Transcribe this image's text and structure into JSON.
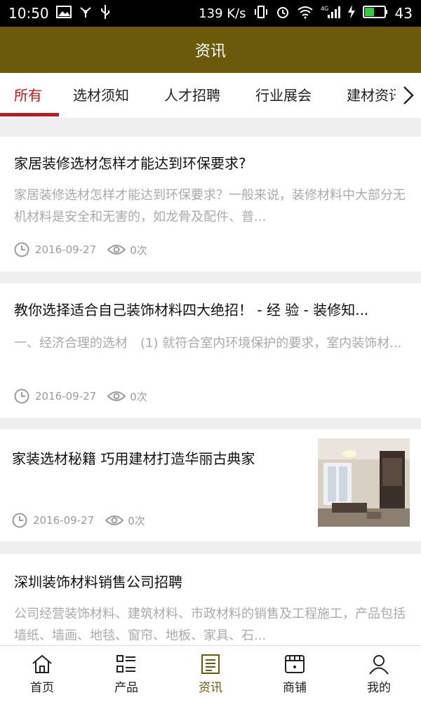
{
  "status_bar": {
    "time": "10:50",
    "speed": "139 K/s",
    "battery": "43",
    "icons": [
      "image-icon",
      "usb-icon",
      "sound-icon",
      "vibrate-icon",
      "alarm-icon",
      "wifi-icon",
      "signal-4g-icon",
      "charging-icon",
      "battery-icon"
    ]
  },
  "header": {
    "title": "资讯"
  },
  "tabs": {
    "items": [
      {
        "label": "所有",
        "active": true
      },
      {
        "label": "选材须知",
        "active": false
      },
      {
        "label": "人才招聘",
        "active": false
      },
      {
        "label": "行业展会",
        "active": false
      },
      {
        "label": "建材资讯",
        "active": false
      }
    ],
    "more_icon": "chevron-right-icon"
  },
  "articles": [
    {
      "title": "家居装修选材怎样才能达到环保要求?",
      "summary": "家居装修选材怎样才能达到环保要求？一般来说，装修材料中大部分无机材料是安全和无害的，如龙骨及配件、普...",
      "date": "2016-09-27",
      "views": "0次"
    },
    {
      "title": "教你选择适合自己装饰材料四大绝招！ - 经 验 - 装修知...",
      "summary": "一、经济合理的选材　(1) 就符合室内环境保护的要求，室内装饰材...",
      "date": "2016-09-27",
      "views": "0次"
    },
    {
      "title": "家装选材秘籍 巧用建材打造华丽古典家",
      "date": "2016-09-27",
      "views": "0次",
      "has_image": true
    },
    {
      "title": "深圳装饰材料销售公司招聘",
      "summary": "公司经营装饰材料、建筑材料、市政材料的销售及工程施工，产品包括墙纸、墙画、地毯、窗帘、地板、家具、石...",
      "date": "",
      "views": ""
    }
  ],
  "bottom_nav": {
    "items": [
      {
        "label": "首页",
        "icon": "home-icon",
        "active": false
      },
      {
        "label": "产品",
        "icon": "list-icon",
        "active": false
      },
      {
        "label": "资讯",
        "icon": "news-icon",
        "active": true
      },
      {
        "label": "商铺",
        "icon": "store-icon",
        "active": false
      },
      {
        "label": "我的",
        "icon": "user-icon",
        "active": false
      }
    ]
  },
  "colors": {
    "header": "#6b5a0b",
    "accent": "#c4161c",
    "muted": "#aaaaaa"
  }
}
